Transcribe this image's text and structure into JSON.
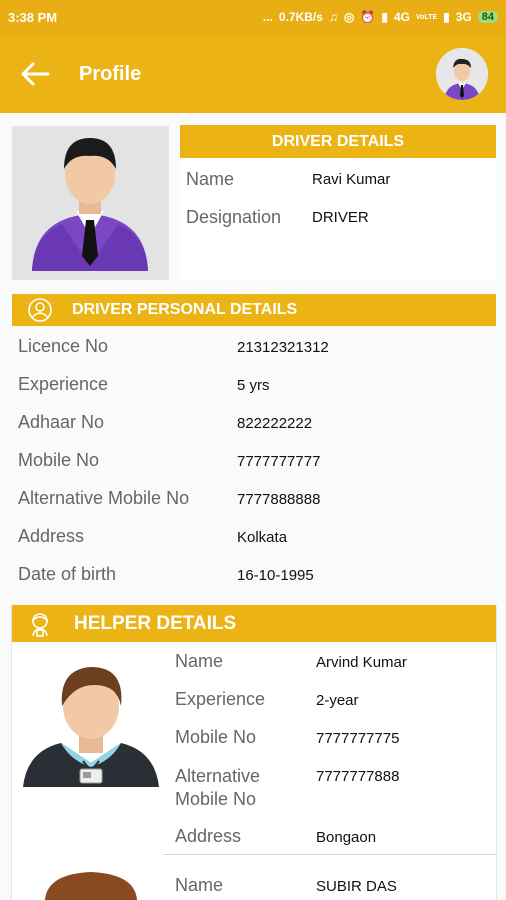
{
  "status": {
    "time": "3:38 PM",
    "dots": "...",
    "speed": "0.7KB/s",
    "net1": "4G",
    "volte": "VoLTE",
    "net2": "3G",
    "battery": "84"
  },
  "appbar": {
    "title": "Profile"
  },
  "driver": {
    "header": "DRIVER DETAILS",
    "fields": [
      {
        "label": "Name",
        "value": "Ravi Kumar"
      },
      {
        "label": "Designation",
        "value": "DRIVER"
      }
    ]
  },
  "personal": {
    "header": "DRIVER PERSONAL DETAILS",
    "fields": [
      {
        "label": "Licence No",
        "value": "21312321312"
      },
      {
        "label": "Experience",
        "value": "5 yrs"
      },
      {
        "label": "Adhaar No",
        "value": "822222222"
      },
      {
        "label": "Mobile No",
        "value": "7777777777"
      },
      {
        "label": "Alternative Mobile No",
        "value": "7777888888"
      },
      {
        "label": "Address",
        "value": "Kolkata"
      },
      {
        "label": "Date of birth",
        "value": "16-10-1995"
      }
    ]
  },
  "helper": {
    "header": "HELPER DETAILS",
    "helpers": [
      {
        "fields": [
          {
            "label": "Name",
            "value": "Arvind Kumar"
          },
          {
            "label": "Experience",
            "value": "2-year"
          },
          {
            "label": "Mobile No",
            "value": "7777777775"
          },
          {
            "label": "Alternative Mobile No",
            "value": "7777777888"
          },
          {
            "label": "Address",
            "value": "Bongaon"
          }
        ]
      },
      {
        "fields": [
          {
            "label": "Name",
            "value": "SUBIR DAS"
          }
        ]
      }
    ]
  },
  "colors": {
    "accent": "#ecb314",
    "statusbar": "#e8ae14"
  }
}
